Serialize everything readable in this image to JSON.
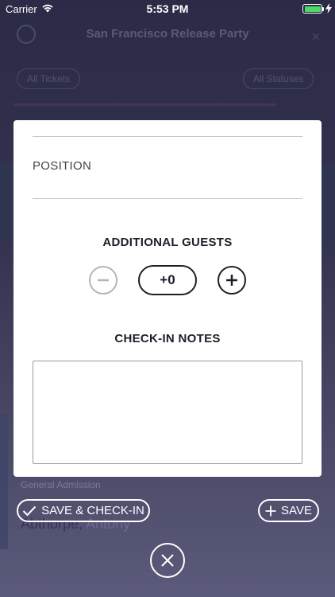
{
  "status_bar": {
    "carrier": "Carrier",
    "time": "5:53 PM",
    "battery_level": 1.0,
    "battery_color": "#4cd964"
  },
  "background": {
    "title": "San Francisco Release Party",
    "filter_left": "All Tickets",
    "filter_right": "All Statuses",
    "row_subtitle": "General Admission",
    "row_last_name": "Abthorpe,",
    "row_first_name": "Antony"
  },
  "modal": {
    "position_label": "POSITION",
    "additional_guests_title": "ADDITIONAL GUESTS",
    "guest_count": "+0",
    "minus_icon": "minus-circle-icon",
    "plus_icon": "plus-circle-icon",
    "checkin_notes_title": "CHECK-IN NOTES",
    "checkin_notes_value": ""
  },
  "actions": {
    "save_checkin_label": "SAVE & CHECK-IN",
    "save_label": "SAVE",
    "close_icon": "close-icon"
  },
  "colors": {
    "accent_dark": "#1e1e2a",
    "disabled": "#b4b4b4",
    "overlay_bg": "#2c2b47"
  }
}
